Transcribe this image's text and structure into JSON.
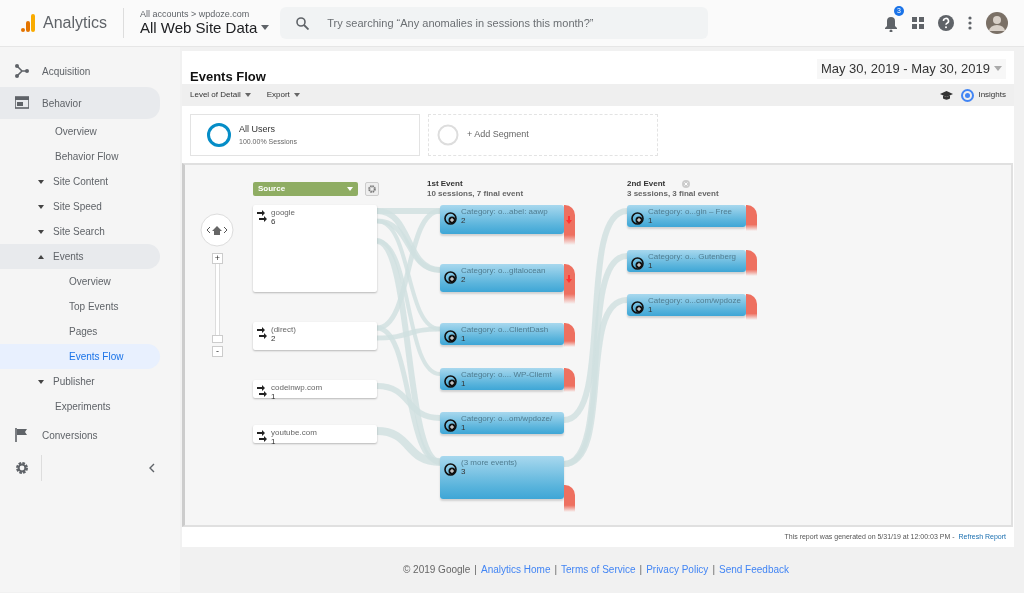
{
  "header": {
    "product": "Analytics",
    "breadcrumb": "All accounts > wpdoze.com",
    "view": "All Web Site Data",
    "search": {
      "placeholder": "Try searching “Any anomalies in sessions this month?”"
    },
    "notifications": "3"
  },
  "sidebar": {
    "items": [
      {
        "label": "Acquisition",
        "expanded": false,
        "selected": false
      },
      {
        "label": "Behavior",
        "expanded": true,
        "selected": false,
        "children": [
          {
            "label": "Overview",
            "selected": false
          },
          {
            "label": "Behavior Flow",
            "selected": false
          },
          {
            "label": "Site Content",
            "expanded": false,
            "selected": false
          },
          {
            "label": "Site Speed",
            "expanded": false,
            "selected": false
          },
          {
            "label": "Site Search",
            "expanded": false,
            "selected": false
          },
          {
            "label": "Events",
            "expanded": true,
            "selected": false,
            "children": [
              {
                "label": "Overview",
                "selected": false
              },
              {
                "label": "Top Events",
                "selected": false
              },
              {
                "label": "Pages",
                "selected": false
              },
              {
                "label": "Events Flow",
                "selected": true
              }
            ]
          },
          {
            "label": "Publisher",
            "expanded": false,
            "selected": false
          },
          {
            "label": "Experiments",
            "selected": false
          }
        ]
      },
      {
        "label": "Conversions",
        "expanded": false,
        "selected": false
      }
    ]
  },
  "report": {
    "title": "Events Flow",
    "date_range": "May 30, 2019 - May 30, 2019",
    "toolbar": [
      "Level of Detail",
      "Export"
    ],
    "insights": "Insights",
    "segments": [
      {
        "title": "All Users",
        "subtitle": "100.00% Sessions"
      }
    ],
    "add_segment": "+ Add Segment",
    "flow": {
      "dimension": "Source",
      "zoom": {
        "zoom_in": "+",
        "zoom_out": "-",
        "level": 0
      },
      "sources": [
        {
          "label": "google",
          "count": "6"
        },
        {
          "label": "(direct)",
          "count": "2"
        },
        {
          "label": "codeinwp.com",
          "count": "1"
        },
        {
          "label": "youtube.com",
          "count": "1"
        }
      ],
      "columns": [
        {
          "title": "1st Event",
          "subtitle": "10 sessions, 7 final event",
          "nodes": [
            {
              "label": "Category: o...abel: aawp",
              "count": "2",
              "dropoff": true,
              "dropoff_arrow": true
            },
            {
              "label": "Category: o...gitalocean",
              "count": "2",
              "dropoff": true,
              "dropoff_arrow": true
            },
            {
              "label": "Category: o...ClientDash",
              "count": "1",
              "dropoff": true,
              "dropoff_arrow": false
            },
            {
              "label": "Category: o.... WP-Cliemt",
              "count": "1",
              "dropoff": true,
              "dropoff_arrow": false
            },
            {
              "label": "Category: o...om/wpdoze/",
              "count": "1",
              "dropoff": false,
              "dropoff_arrow": false
            },
            {
              "label": "(3 more events)",
              "count": "3",
              "dropoff": true,
              "dropoff_arrow": false
            }
          ]
        },
        {
          "title": "2nd Event",
          "subtitle": "3 sessions, 3 final event",
          "nodes": [
            {
              "label": "Category: o...gin – Free",
              "count": "1",
              "dropoff": true,
              "dropoff_arrow": false
            },
            {
              "label": "Category: o... Gutenberg",
              "count": "1",
              "dropoff": true,
              "dropoff_arrow": false
            },
            {
              "label": "Category: o...com/wpdoze",
              "count": "1",
              "dropoff": true,
              "dropoff_arrow": false
            }
          ]
        }
      ]
    },
    "generated_note": "This report was generated on 5/31/19 at 12:00:03 PM -",
    "refresh": "Refresh Report"
  },
  "footer": {
    "copyright": "© 2019 Google",
    "separator": "|",
    "links": [
      "Analytics Home",
      "Terms of Service",
      "Privacy Policy",
      "Send Feedback"
    ]
  }
}
